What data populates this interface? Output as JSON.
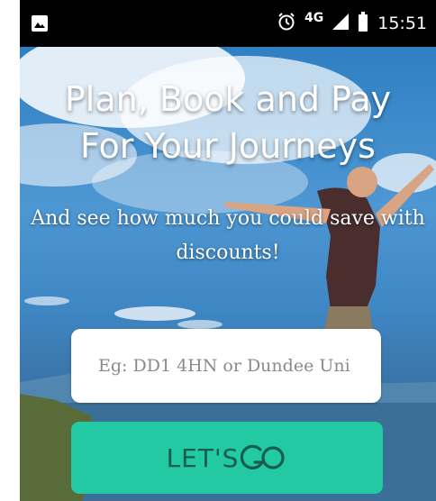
{
  "status_bar": {
    "network": "4G",
    "time": "15:51",
    "icons": [
      "image-icon",
      "alarm-icon",
      "signal-icon",
      "battery-icon"
    ]
  },
  "hero": {
    "title_line1": "Plan, Book and Pay",
    "title_line2": "For Your Journeys",
    "subtitle_line1": "And see how much you could save with",
    "subtitle_line2": "discounts!"
  },
  "search": {
    "placeholder": "Eg: DD1 4HN or Dundee Uni",
    "value": ""
  },
  "cta": {
    "label": "LET'S",
    "icon": "go-icon"
  },
  "colors": {
    "status_bar": "#000000",
    "accent": "#22c9a2",
    "accent_text": "#155d4c",
    "sky": "#3f86c4"
  }
}
